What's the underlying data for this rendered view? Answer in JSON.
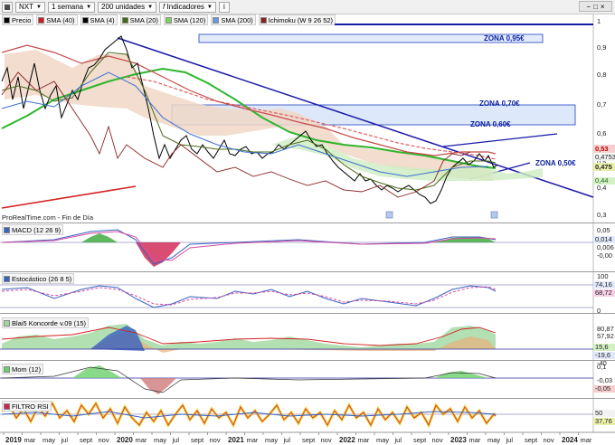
{
  "toolbar": {
    "symbol": "NXT",
    "timeframe": "1 semana",
    "units": "200 unidades",
    "indicators_label": "Indicadores",
    "info_icon": "info-icon"
  },
  "legend": [
    {
      "label": "Precio",
      "color": "#000000"
    },
    {
      "label": "SMA (40)",
      "color": "#c81e1e"
    },
    {
      "label": "SMA (4)",
      "color": "#000000"
    },
    {
      "label": "SMA (20)",
      "color": "#3b6b14"
    },
    {
      "label": "SMA (120)",
      "color": "#7cd35a"
    },
    {
      "label": "SMA (200)",
      "color": "#6699dd"
    },
    {
      "label": "Ichimoku (W 9 26 52)",
      "color": "#8a2222"
    }
  ],
  "main_chart": {
    "source_text": "ProRealTime.com - Fin de Día",
    "zones": [
      "ZONA 0,95€",
      "ZONA 0,70€",
      "ZONA 0,60€",
      "ZONA 0,50€"
    ],
    "y_ticks": [
      "1",
      "0,9",
      "0,8",
      "0,7",
      "0,6",
      "0,5",
      "0,4",
      "0,3"
    ],
    "price_badges": [
      "0,53",
      "0,4753",
      "0,475",
      "0,44"
    ]
  },
  "panes": {
    "macd": {
      "label": "MACD (12 26 9)",
      "values": [
        "0,05",
        "0,014",
        "0,006",
        "-0,00"
      ]
    },
    "stoch": {
      "label": "Estocástico (26 8 5)",
      "values": [
        "100",
        "74,16",
        "68,72",
        "0"
      ]
    },
    "blai": {
      "label": "Blai5 Koncorde v.09 (15)",
      "values": [
        "80,87",
        "57,92",
        "15,6",
        "-19,6",
        "-40"
      ]
    },
    "mom": {
      "label": "Mom (12)",
      "values": [
        "0,1",
        "-0,03",
        "-0,05"
      ]
    },
    "rsi": {
      "label": "FILTRO RSI",
      "values": [
        "50",
        "37,76"
      ]
    }
  },
  "x_axis": [
    "2019",
    "mar",
    "may",
    "jul",
    "sept",
    "nov",
    "2020",
    "mar",
    "may",
    "jul",
    "sept",
    "nov",
    "2021",
    "mar",
    "may",
    "jul",
    "sept",
    "nov",
    "2022",
    "mar",
    "may",
    "jul",
    "sept",
    "nov",
    "2023",
    "mar",
    "may",
    "jul",
    "sept",
    "nov",
    "2024",
    "mar"
  ],
  "colors": {
    "trendline": "#1a1aa8",
    "zone_fill": "#dde8fb",
    "zone_stroke": "#2040c0",
    "green_sma": "#2db52d",
    "red_line": "#d22020"
  }
}
